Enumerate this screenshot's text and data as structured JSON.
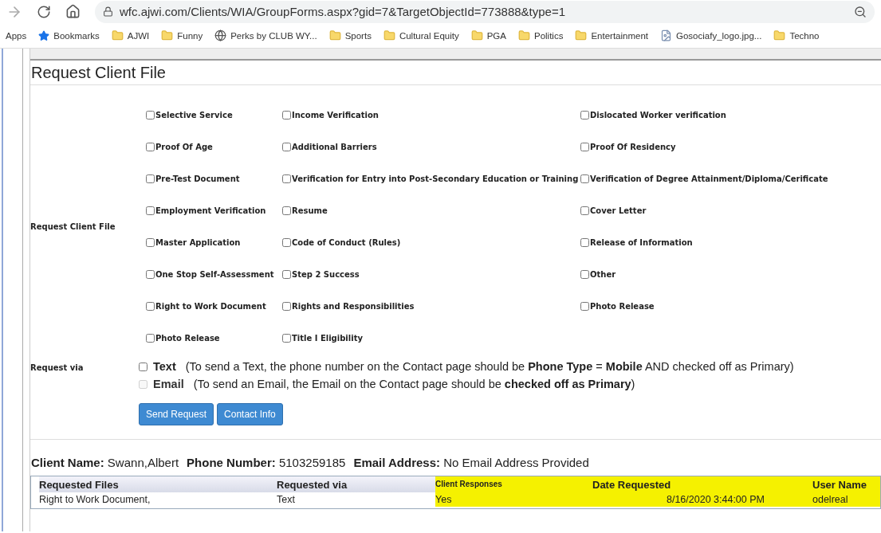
{
  "browser": {
    "address": "wfc.ajwi.com/Clients/WIA/GroupForms.aspx?gid=7&TargetObjectId=773888&type=1",
    "bookmarks": [
      {
        "label": "Apps",
        "kind": "plain"
      },
      {
        "label": "Bookmarks",
        "kind": "star"
      },
      {
        "label": "AJWI",
        "kind": "folder"
      },
      {
        "label": "Funny",
        "kind": "folder"
      },
      {
        "label": "Perks by CLUB WY...",
        "kind": "globe"
      },
      {
        "label": "Sports",
        "kind": "folder"
      },
      {
        "label": "Cultural Equity",
        "kind": "folder"
      },
      {
        "label": "PGA",
        "kind": "folder"
      },
      {
        "label": "Politics",
        "kind": "folder"
      },
      {
        "label": "Entertainment",
        "kind": "folder"
      },
      {
        "label": "Gosociafy_logo.jpg...",
        "kind": "file"
      },
      {
        "label": "Techno",
        "kind": "folder"
      }
    ]
  },
  "form": {
    "title": "Request Client File",
    "section_label": "Request Client File",
    "options": [
      [
        {
          "label": "Selective Service",
          "checked": false
        },
        {
          "label": "Income Verification",
          "checked": false
        },
        {
          "label": "Dislocated Worker verification",
          "checked": false
        }
      ],
      [
        {
          "label": "Proof Of Age",
          "checked": false
        },
        {
          "label": "Additional Barriers",
          "checked": false
        },
        {
          "label": "Proof Of Residency",
          "checked": false
        }
      ],
      [
        {
          "label": "Pre-Test Document",
          "checked": false
        },
        {
          "label": "Verification for Entry into Post-Secondary Education or Training",
          "checked": false
        },
        {
          "label": "Verification of Degree Attainment/Diploma/Cerificate",
          "checked": false
        }
      ],
      [
        {
          "label": "Employment Verification",
          "checked": false
        },
        {
          "label": "Resume",
          "checked": false
        },
        {
          "label": "Cover Letter",
          "checked": false
        }
      ],
      [
        {
          "label": "Master Application",
          "checked": false
        },
        {
          "label": "Code of Conduct (Rules)",
          "checked": false
        },
        {
          "label": "Release of Information",
          "checked": false
        }
      ],
      [
        {
          "label": "One Stop Self-Assessment",
          "checked": false
        },
        {
          "label": "Step 2 Success",
          "checked": false
        },
        {
          "label": "Other",
          "checked": false
        }
      ],
      [
        {
          "label": "Right to Work Document",
          "checked": false
        },
        {
          "label": "Rights and Responsibilities",
          "checked": false
        },
        {
          "label": "Photo Release",
          "checked": false
        }
      ],
      [
        {
          "label": "Photo Release",
          "checked": false
        },
        {
          "label": "Title I Eligibility",
          "checked": false
        }
      ]
    ],
    "request_via": {
      "label": "Request via",
      "methods": [
        {
          "label": "Text",
          "checked": false,
          "disabled": false,
          "note": "(To send a Text, the phone number on the Contact page should be **Phone Type** = **Mobile** AND checked off as Primary)"
        },
        {
          "label": "Email",
          "checked": false,
          "disabled": true,
          "note": "(To send an Email, the Email on the Contact page should be **checked off as Primary**)"
        }
      ]
    },
    "buttons": [
      "Send Request",
      "Contact Info"
    ]
  },
  "client": [
    {
      "label": "Client Name:",
      "value": "Swann,Albert"
    },
    {
      "label": "Phone Number:",
      "value": "5103259185"
    },
    {
      "label": "Email Address:",
      "value": "No Email Address Provided"
    }
  ],
  "table": {
    "columns": [
      {
        "label": "Requested Files",
        "highlighted": false
      },
      {
        "label": "Requested via",
        "highlighted": false
      },
      {
        "label": "Client Responses",
        "highlighted": true
      },
      {
        "label": "Date Requested",
        "highlighted": true
      },
      {
        "label": "User Name",
        "highlighted": true
      }
    ],
    "rows": [
      [
        "Right to Work Document,",
        "Text",
        "Yes",
        "8/16/2020 3:44:00 PM",
        "odelreal"
      ]
    ]
  }
}
